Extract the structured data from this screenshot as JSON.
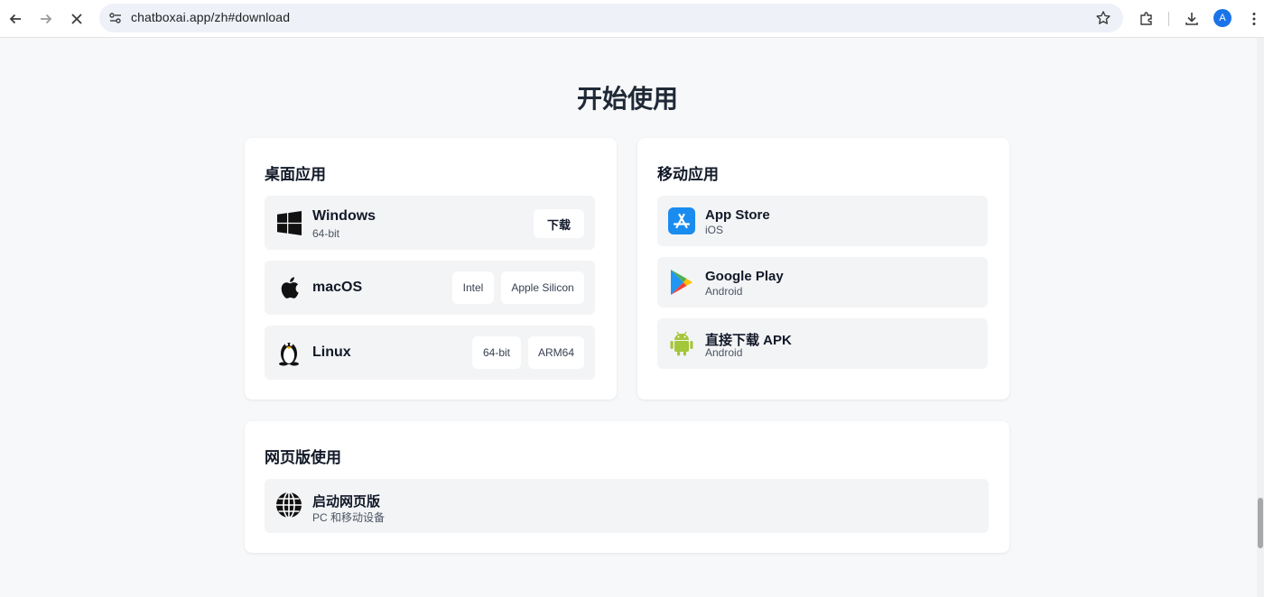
{
  "browser": {
    "url": "chatboxai.app/zh#download",
    "avatar_letter": "A"
  },
  "page": {
    "title": "开始使用"
  },
  "desktop": {
    "title": "桌面应用",
    "windows": {
      "name": "Windows",
      "sub": "64-bit",
      "button": "下载"
    },
    "macos": {
      "name": "macOS",
      "buttons": [
        "Intel",
        "Apple Silicon"
      ]
    },
    "linux": {
      "name": "Linux",
      "buttons": [
        "64-bit",
        "ARM64"
      ]
    }
  },
  "mobile": {
    "title": "移动应用",
    "items": [
      {
        "name": "App Store",
        "sub": "iOS",
        "icon": "app-store-icon"
      },
      {
        "name": "Google Play",
        "sub": "Android",
        "icon": "google-play-icon"
      },
      {
        "name": "直接下载 APK",
        "sub": "Android",
        "icon": "android-icon"
      }
    ]
  },
  "web": {
    "title": "网页版使用",
    "item": {
      "name": "启动网页版",
      "sub": "PC 和移动设备",
      "icon": "globe-icon"
    }
  },
  "colors": {
    "app_store_blue": "#1a8cf0",
    "android_green": "#a4c639",
    "avatar_blue": "#1a73e8"
  }
}
